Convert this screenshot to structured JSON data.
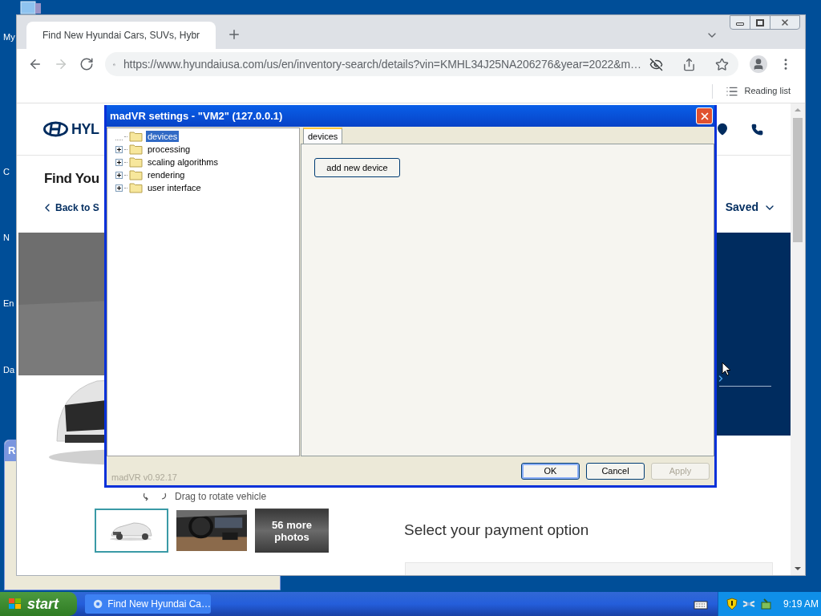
{
  "desktop": {
    "icon_labels": [
      "My",
      "C",
      "N",
      "En",
      "Da"
    ]
  },
  "background_window": {
    "title": "R"
  },
  "browser": {
    "tabs": [
      {
        "title": "Find New Hyundai Cars, SUVs, Hybr",
        "selected": true
      }
    ],
    "nav_buttons": [
      {
        "kind": "back",
        "disabled": false
      },
      {
        "kind": "forward",
        "disabled": true
      },
      {
        "kind": "reload",
        "disabled": false
      }
    ],
    "url": "https://www.hyundaiusa.com/us/en/inventory-search/details?vin=KMHL34J25NA206276&year=2022&m…",
    "reading_list": "Reading list",
    "page": {
      "logo_text": "HYL",
      "heading": "Find You",
      "back_link": "Back to S",
      "saved": "Saved",
      "rotate_hint": "Drag to rotate vehicle",
      "thumbnails": [
        {
          "kind": "picture",
          "selected": true
        },
        {
          "kind": "picture",
          "selected": false
        },
        {
          "kind": "more",
          "label": "56 more photos",
          "selected": false
        }
      ],
      "payment_heading": "Select your payment option"
    }
  },
  "dialog": {
    "title": "madVR settings - \"VM2\" (127.0.0.1)",
    "tree": [
      {
        "label": "devices",
        "has_children": false,
        "selected": true
      },
      {
        "label": "processing",
        "has_children": true,
        "selected": false
      },
      {
        "label": "scaling algorithms",
        "has_children": true,
        "selected": false
      },
      {
        "label": "rendering",
        "has_children": true,
        "selected": false
      },
      {
        "label": "user interface",
        "has_children": true,
        "selected": false
      }
    ],
    "tabs": [
      {
        "label": "devices",
        "selected": true
      }
    ],
    "add_button": "add new device",
    "version": "madVR v0.92.17",
    "buttons": [
      {
        "label": "OK",
        "default": true,
        "disabled": false
      },
      {
        "label": "Cancel",
        "default": false,
        "disabled": false
      },
      {
        "label": "Apply",
        "default": false,
        "disabled": true
      }
    ]
  },
  "taskbar": {
    "start": "start",
    "tasks": [
      {
        "label": "Find New Hyundai Ca…",
        "selected": false
      }
    ],
    "clock": "9:19 AM"
  }
}
